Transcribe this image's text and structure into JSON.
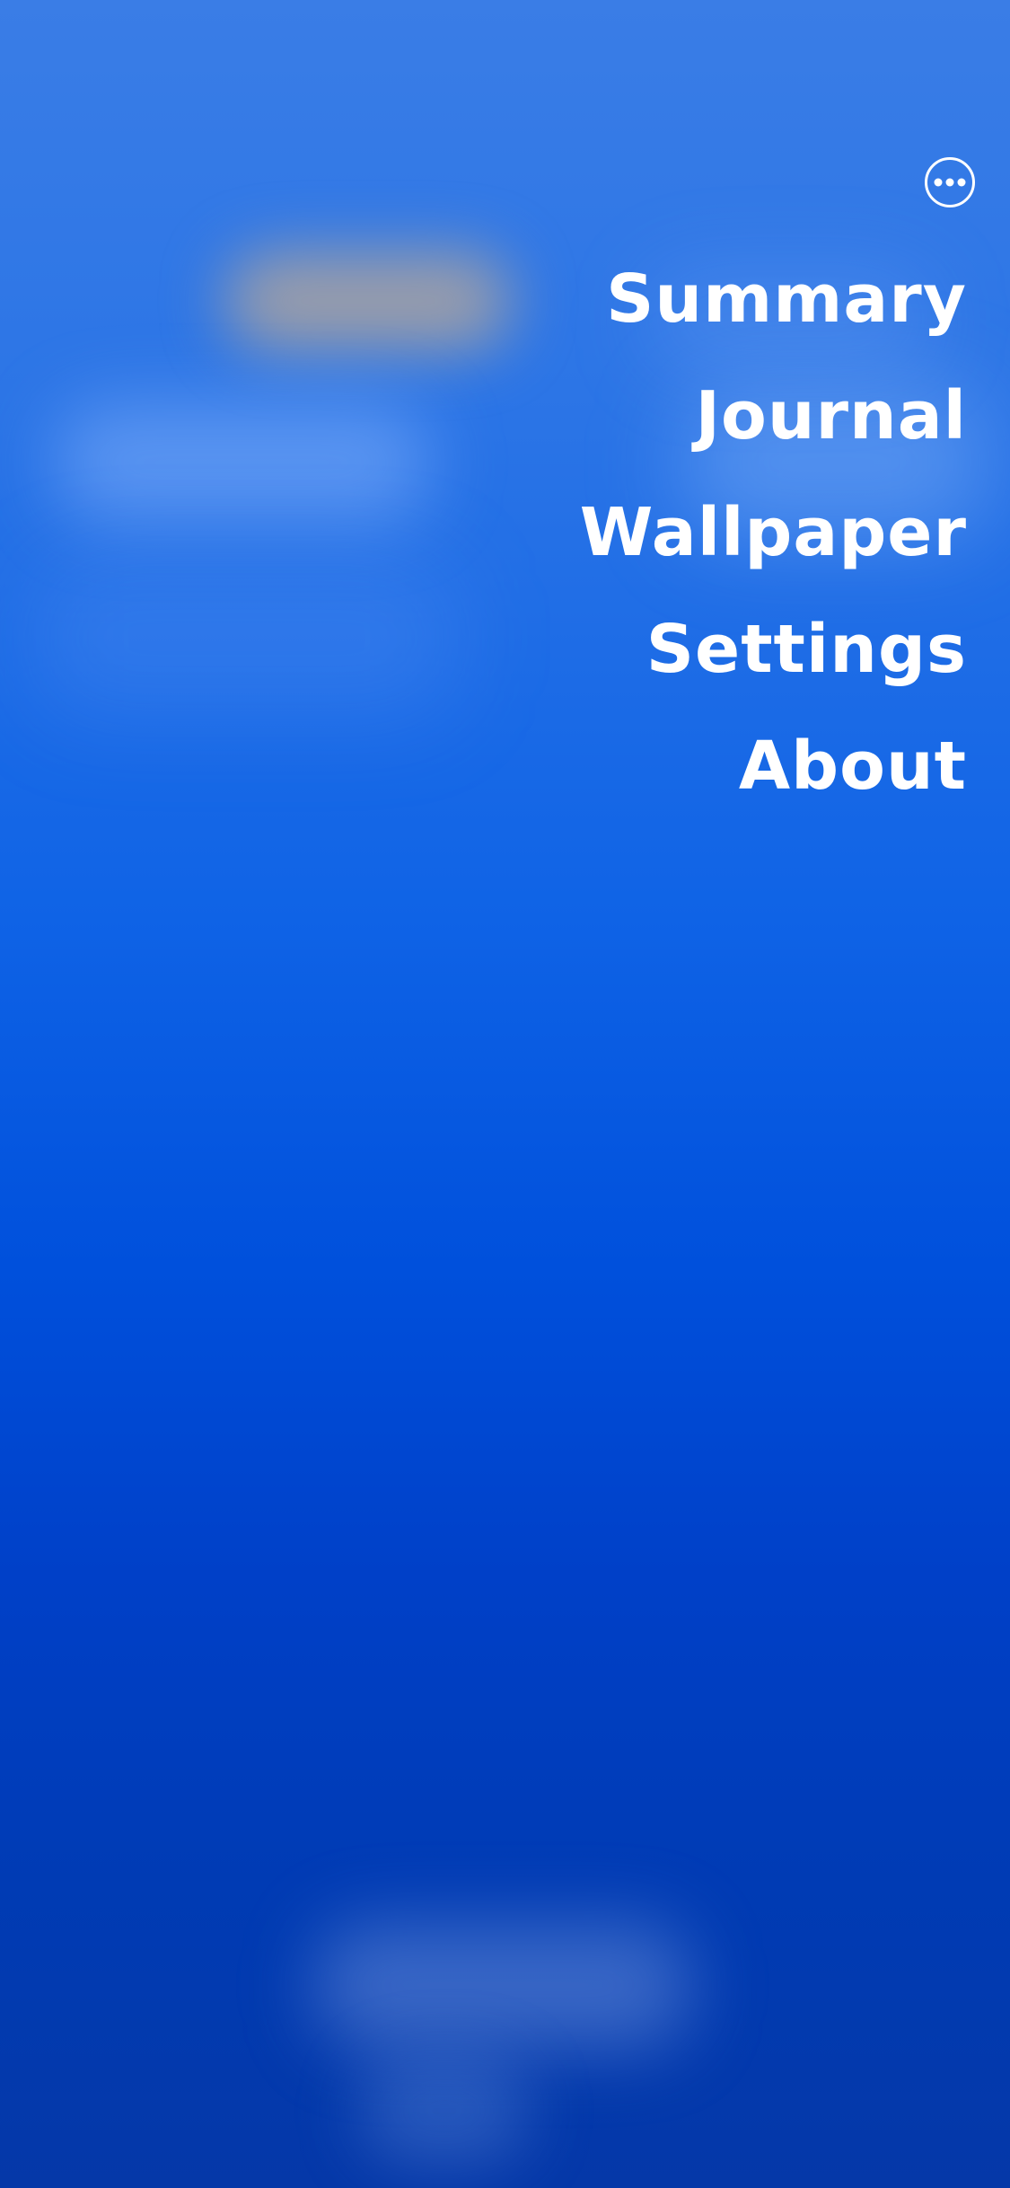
{
  "menu": {
    "more_icon": "ellipsis-circle-icon",
    "items": [
      {
        "label": "Summary"
      },
      {
        "label": "Journal"
      },
      {
        "label": "Wallpaper"
      },
      {
        "label": "Settings"
      },
      {
        "label": "About"
      }
    ]
  },
  "colors": {
    "text": "#ffffff",
    "background_top": "#3a7de6",
    "background_bottom": "#0538a8"
  }
}
